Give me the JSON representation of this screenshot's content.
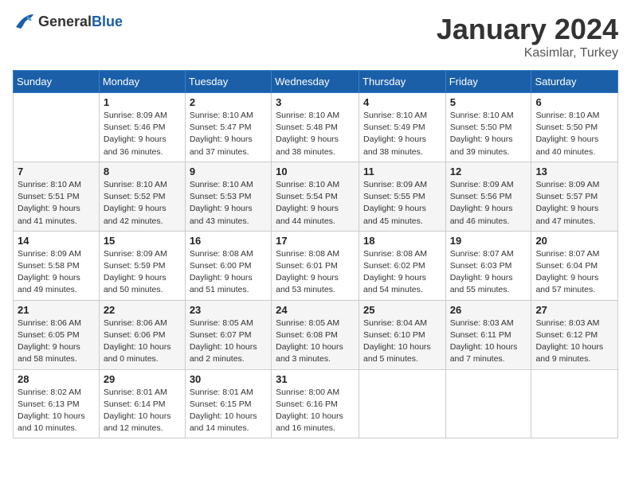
{
  "logo": {
    "general": "General",
    "blue": "Blue"
  },
  "header": {
    "month": "January 2024",
    "location": "Kasimlar, Turkey"
  },
  "weekdays": [
    "Sunday",
    "Monday",
    "Tuesday",
    "Wednesday",
    "Thursday",
    "Friday",
    "Saturday"
  ],
  "weeks": [
    [
      {
        "day": "",
        "info": ""
      },
      {
        "day": "1",
        "info": "Sunrise: 8:09 AM\nSunset: 5:46 PM\nDaylight: 9 hours\nand 36 minutes."
      },
      {
        "day": "2",
        "info": "Sunrise: 8:10 AM\nSunset: 5:47 PM\nDaylight: 9 hours\nand 37 minutes."
      },
      {
        "day": "3",
        "info": "Sunrise: 8:10 AM\nSunset: 5:48 PM\nDaylight: 9 hours\nand 38 minutes."
      },
      {
        "day": "4",
        "info": "Sunrise: 8:10 AM\nSunset: 5:49 PM\nDaylight: 9 hours\nand 38 minutes."
      },
      {
        "day": "5",
        "info": "Sunrise: 8:10 AM\nSunset: 5:50 PM\nDaylight: 9 hours\nand 39 minutes."
      },
      {
        "day": "6",
        "info": "Sunrise: 8:10 AM\nSunset: 5:50 PM\nDaylight: 9 hours\nand 40 minutes."
      }
    ],
    [
      {
        "day": "7",
        "info": "Sunrise: 8:10 AM\nSunset: 5:51 PM\nDaylight: 9 hours\nand 41 minutes."
      },
      {
        "day": "8",
        "info": "Sunrise: 8:10 AM\nSunset: 5:52 PM\nDaylight: 9 hours\nand 42 minutes."
      },
      {
        "day": "9",
        "info": "Sunrise: 8:10 AM\nSunset: 5:53 PM\nDaylight: 9 hours\nand 43 minutes."
      },
      {
        "day": "10",
        "info": "Sunrise: 8:10 AM\nSunset: 5:54 PM\nDaylight: 9 hours\nand 44 minutes."
      },
      {
        "day": "11",
        "info": "Sunrise: 8:09 AM\nSunset: 5:55 PM\nDaylight: 9 hours\nand 45 minutes."
      },
      {
        "day": "12",
        "info": "Sunrise: 8:09 AM\nSunset: 5:56 PM\nDaylight: 9 hours\nand 46 minutes."
      },
      {
        "day": "13",
        "info": "Sunrise: 8:09 AM\nSunset: 5:57 PM\nDaylight: 9 hours\nand 47 minutes."
      }
    ],
    [
      {
        "day": "14",
        "info": "Sunrise: 8:09 AM\nSunset: 5:58 PM\nDaylight: 9 hours\nand 49 minutes."
      },
      {
        "day": "15",
        "info": "Sunrise: 8:09 AM\nSunset: 5:59 PM\nDaylight: 9 hours\nand 50 minutes."
      },
      {
        "day": "16",
        "info": "Sunrise: 8:08 AM\nSunset: 6:00 PM\nDaylight: 9 hours\nand 51 minutes."
      },
      {
        "day": "17",
        "info": "Sunrise: 8:08 AM\nSunset: 6:01 PM\nDaylight: 9 hours\nand 53 minutes."
      },
      {
        "day": "18",
        "info": "Sunrise: 8:08 AM\nSunset: 6:02 PM\nDaylight: 9 hours\nand 54 minutes."
      },
      {
        "day": "19",
        "info": "Sunrise: 8:07 AM\nSunset: 6:03 PM\nDaylight: 9 hours\nand 55 minutes."
      },
      {
        "day": "20",
        "info": "Sunrise: 8:07 AM\nSunset: 6:04 PM\nDaylight: 9 hours\nand 57 minutes."
      }
    ],
    [
      {
        "day": "21",
        "info": "Sunrise: 8:06 AM\nSunset: 6:05 PM\nDaylight: 9 hours\nand 58 minutes."
      },
      {
        "day": "22",
        "info": "Sunrise: 8:06 AM\nSunset: 6:06 PM\nDaylight: 10 hours\nand 0 minutes."
      },
      {
        "day": "23",
        "info": "Sunrise: 8:05 AM\nSunset: 6:07 PM\nDaylight: 10 hours\nand 2 minutes."
      },
      {
        "day": "24",
        "info": "Sunrise: 8:05 AM\nSunset: 6:08 PM\nDaylight: 10 hours\nand 3 minutes."
      },
      {
        "day": "25",
        "info": "Sunrise: 8:04 AM\nSunset: 6:10 PM\nDaylight: 10 hours\nand 5 minutes."
      },
      {
        "day": "26",
        "info": "Sunrise: 8:03 AM\nSunset: 6:11 PM\nDaylight: 10 hours\nand 7 minutes."
      },
      {
        "day": "27",
        "info": "Sunrise: 8:03 AM\nSunset: 6:12 PM\nDaylight: 10 hours\nand 9 minutes."
      }
    ],
    [
      {
        "day": "28",
        "info": "Sunrise: 8:02 AM\nSunset: 6:13 PM\nDaylight: 10 hours\nand 10 minutes."
      },
      {
        "day": "29",
        "info": "Sunrise: 8:01 AM\nSunset: 6:14 PM\nDaylight: 10 hours\nand 12 minutes."
      },
      {
        "day": "30",
        "info": "Sunrise: 8:01 AM\nSunset: 6:15 PM\nDaylight: 10 hours\nand 14 minutes."
      },
      {
        "day": "31",
        "info": "Sunrise: 8:00 AM\nSunset: 6:16 PM\nDaylight: 10 hours\nand 16 minutes."
      },
      {
        "day": "",
        "info": ""
      },
      {
        "day": "",
        "info": ""
      },
      {
        "day": "",
        "info": ""
      }
    ]
  ]
}
